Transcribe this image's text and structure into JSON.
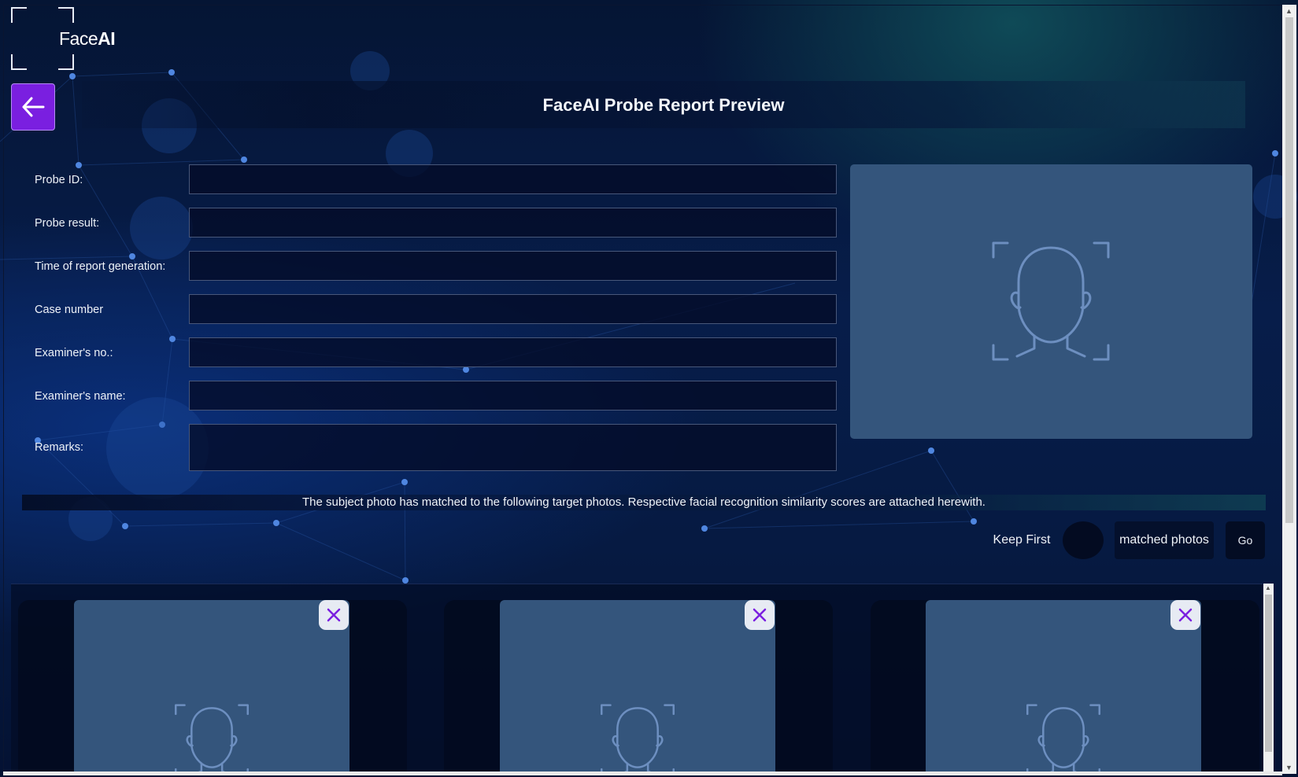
{
  "app": {
    "logo_light": "Face",
    "logo_bold": "AI"
  },
  "header": {
    "title": "FaceAI Probe Report Preview"
  },
  "form": {
    "fields": [
      {
        "label": "Probe ID:",
        "value": ""
      },
      {
        "label": "Probe result:",
        "value": ""
      },
      {
        "label": "Time of report generation:",
        "value": ""
      },
      {
        "label": "Case number",
        "value": ""
      },
      {
        "label": "Examiner's no.:",
        "value": ""
      },
      {
        "label": "Examiner's name:",
        "value": ""
      },
      {
        "label": "Remarks:",
        "value": ""
      }
    ]
  },
  "probe_photo": {
    "icon": "face-scan-icon"
  },
  "notice": "The subject photo has matched to the following target photos. Respective facial recognition similarity scores are attached herewith.",
  "filter": {
    "keep_label": "Keep First",
    "count_value": "",
    "suffix_label": "matched photos",
    "go_label": "Go"
  },
  "matches": [
    {
      "icon": "face-scan-icon",
      "remove_icon": "close-icon"
    },
    {
      "icon": "face-scan-icon",
      "remove_icon": "close-icon"
    },
    {
      "icon": "face-scan-icon",
      "remove_icon": "close-icon"
    }
  ],
  "colors": {
    "accent": "#7a1fe0",
    "photo_placeholder": "#34557c",
    "background": "#061a42"
  }
}
